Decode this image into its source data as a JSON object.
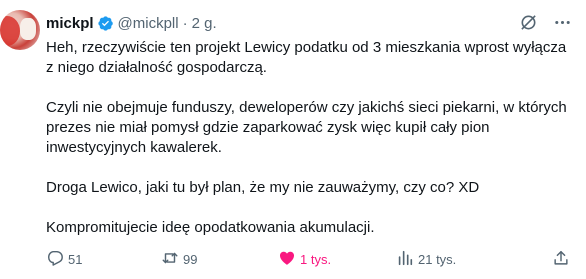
{
  "tweet": {
    "display_name": "mickpl",
    "handle": "@mickpll",
    "separator": "·",
    "time": "2 g.",
    "paragraphs": [
      "Heh, rzeczywiście ten projekt Lewicy podatku od 3 mieszkania wprost wyłącza z niego działalność gospodarczą.",
      "Czyli nie obejmuje funduszy, deweloperów czy jakichś sieci piekarni, w których prezes nie miał pomysł gdzie zaparkować zysk więc kupił cały pion inwestycyjnych kawalerek.",
      "Droga Lewico, jaki tu był plan, że my nie zauważymy, czy co? XD",
      "Kompromitujecie ideę opodatkowania akumulacji."
    ],
    "stats": {
      "replies": "51",
      "retweets": "99",
      "likes": "1 tys.",
      "views": "21 tys."
    }
  },
  "colors": {
    "text": "#0f1419",
    "secondary": "#536471",
    "verified": "#1d9bf0",
    "like": "#f91880"
  },
  "icons": {
    "verified": "verified-badge-icon",
    "grok": "grok-icon",
    "more": "more-icon",
    "reply": "reply-icon",
    "retweet": "retweet-icon",
    "like": "heart-icon",
    "views": "views-icon",
    "share": "share-icon"
  }
}
